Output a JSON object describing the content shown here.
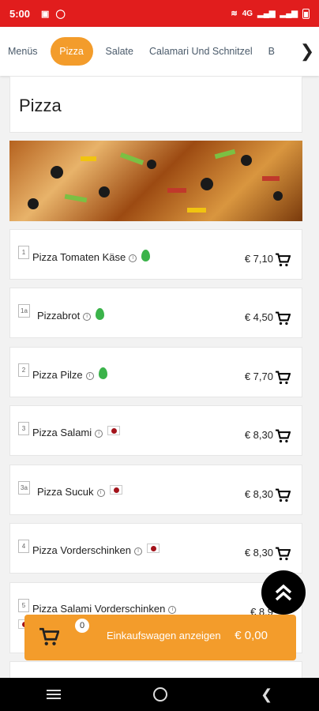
{
  "status_bar": {
    "time": "5:00",
    "network": "4G"
  },
  "tabs": [
    {
      "label": "Menüs",
      "active": false
    },
    {
      "label": "Pizza",
      "active": true
    },
    {
      "label": "Salate",
      "active": false
    },
    {
      "label": "Calamari Und Schnitzel",
      "active": false
    },
    {
      "label": "B",
      "active": false
    }
  ],
  "section": {
    "title": "Pizza"
  },
  "items": [
    {
      "num": "1",
      "name": "Pizza Tomaten Käse",
      "price": "€ 7,10",
      "tag": "vegetarian-leaf-icon"
    },
    {
      "num": "1a",
      "name": "Pizzabrot",
      "price": "€ 4,50",
      "tag": "vegetarian-leaf-icon"
    },
    {
      "num": "2",
      "name": "Pizza Pilze",
      "price": "€ 7,70",
      "tag": "vegetarian-leaf-icon"
    },
    {
      "num": "3",
      "name": "Pizza Salami",
      "price": "€ 8,30",
      "tag": "meat-icon"
    },
    {
      "num": "3a",
      "name": "Pizza Sucuk",
      "price": "€ 8,30",
      "tag": "meat-icon"
    },
    {
      "num": "4",
      "name": "Pizza Vorderschinken",
      "price": "€ 8,30",
      "tag": "meat-icon"
    },
    {
      "num": "5",
      "name": "Pizza Salami Vorderschinken",
      "price": "€ 8,9",
      "tag": "meat-icon"
    }
  ],
  "cart": {
    "count": "0",
    "label": "Einkaufswagen anzeigen",
    "total": "€ 0,00"
  },
  "colors": {
    "status_bar": "#e11d1d",
    "accent": "#f39c2b"
  }
}
